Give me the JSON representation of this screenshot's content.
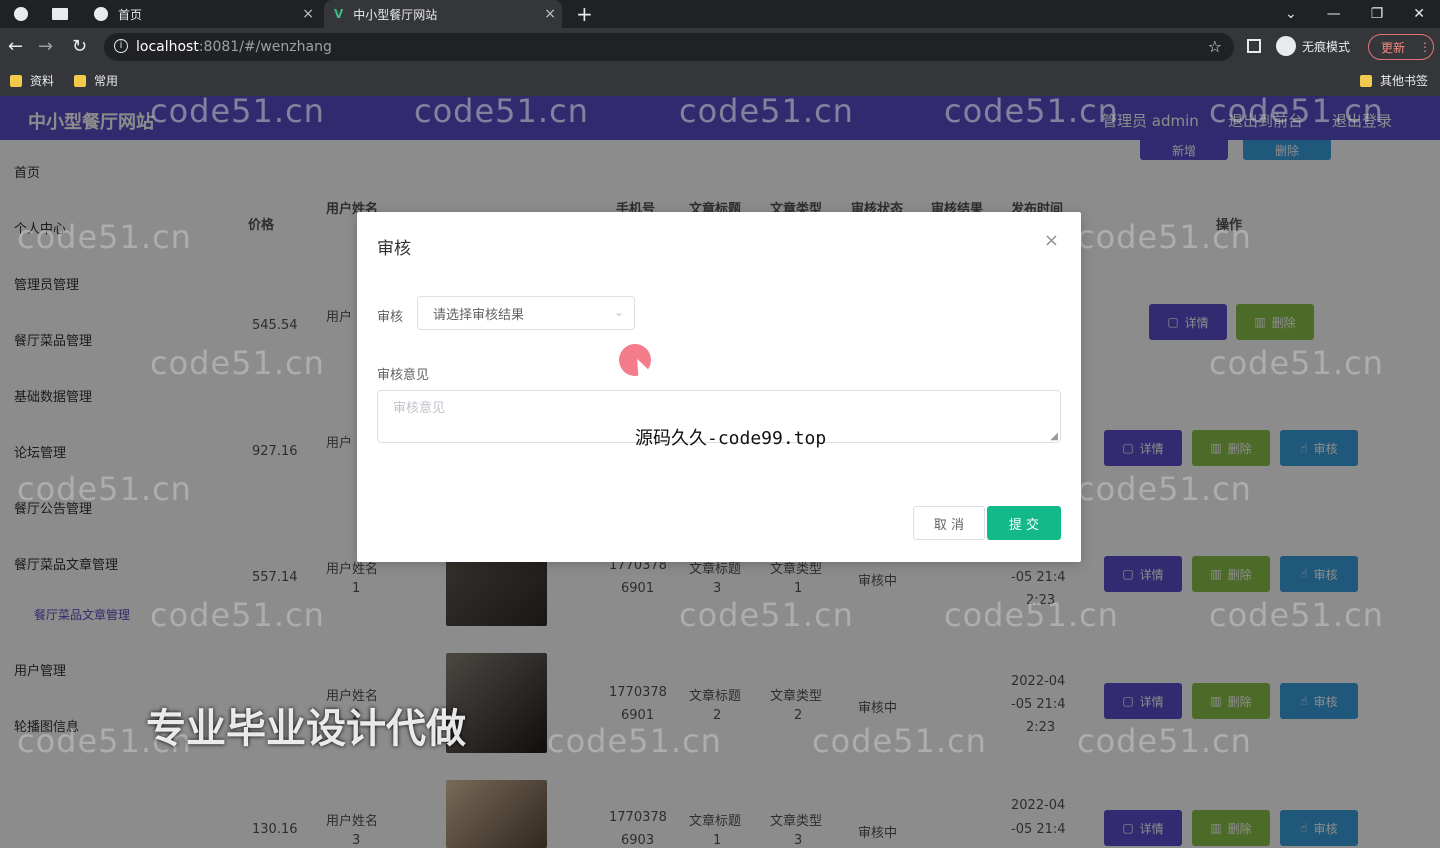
{
  "browser": {
    "tabs": [
      {
        "label": "首页"
      },
      {
        "label": "中小型餐厅网站"
      }
    ],
    "url_host": "localhost",
    "url_path": ":8081/#/wenzhang",
    "incognito_label": "无痕模式",
    "update_label": "更新",
    "bookmarks": [
      "资料",
      "常用"
    ],
    "other_bookmarks": "其他书签"
  },
  "app": {
    "title": "中小型餐厅网站",
    "user_label": "管理员 admin",
    "front_label": "退出到前台",
    "logout_label": "退出登录"
  },
  "sidebar": {
    "items": [
      "首页",
      "个人中心",
      "管理员管理",
      "餐厅菜品管理",
      "基础数据管理",
      "论坛管理",
      "餐厅公告管理",
      "餐厅菜品文章管理",
      "餐厅菜品文章管理",
      "用户管理",
      "轮播图信息"
    ]
  },
  "table": {
    "headers": [
      "价格",
      "用户姓名",
      "手机号",
      "文章标题",
      "文章类型",
      "审核状态",
      "审核结果",
      "发布时间",
      "操作"
    ],
    "top_buttons": [
      "新增",
      "删除"
    ],
    "rows": [
      {
        "price": "545.54",
        "user": "用户",
        "phone": "",
        "title": "",
        "type": "",
        "status": "",
        "time": "",
        "actions": [
          "详情",
          "删除"
        ]
      },
      {
        "price": "927.16",
        "user": "用户",
        "phone": "",
        "title": "",
        "type": "",
        "status": "",
        "time": "",
        "actions": [
          "详情",
          "删除",
          "审核"
        ]
      },
      {
        "price": "557.14",
        "user": "用户姓名",
        "user2": "1",
        "phone": "1770378",
        "phone2": "6901",
        "title": "文章标题",
        "title2": "3",
        "type": "文章类型",
        "type2": "1",
        "status": "审核中",
        "time": "-05 21:4",
        "time2": "2:23",
        "actions": [
          "详情",
          "删除",
          "审核"
        ]
      },
      {
        "price": "",
        "user": "用户姓名",
        "user2": "2",
        "phone": "1770378",
        "phone2": "6901",
        "title": "文章标题",
        "title2": "2",
        "type": "文章类型",
        "type2": "2",
        "status": "审核中",
        "time": "2022-04",
        "time2": "-05 21:4",
        "time3": "2:23",
        "actions": [
          "详情",
          "删除",
          "审核"
        ]
      },
      {
        "price": "130.16",
        "user": "用户姓名",
        "user2": "3",
        "phone": "1770378",
        "phone2": "6903",
        "title": "文章标题",
        "title2": "1",
        "type": "文章类型",
        "type2": "3",
        "status": "审核中",
        "time": "2022-04",
        "time2": "-05 21:4",
        "actions": [
          "详情",
          "删除",
          "审核"
        ]
      }
    ]
  },
  "modal": {
    "title": "审核",
    "field_audit_label": "审核",
    "select_placeholder": "请选择审核结果",
    "field_opinion_label": "审核意见",
    "textarea_placeholder": "审核意见",
    "cancel_label": "取 消",
    "submit_label": "提 交"
  },
  "overlay_text": {
    "source": "源码久久-code99.top",
    "promo": "专业毕业设计代做",
    "watermark": "code51.cn"
  },
  "colors": {
    "primary_purple": "#5a4ec8",
    "detail_btn": "#5b4fcf",
    "delete_btn": "#8bc34a",
    "audit_btn": "#3aa0e0",
    "submit_btn": "#14b98a"
  }
}
